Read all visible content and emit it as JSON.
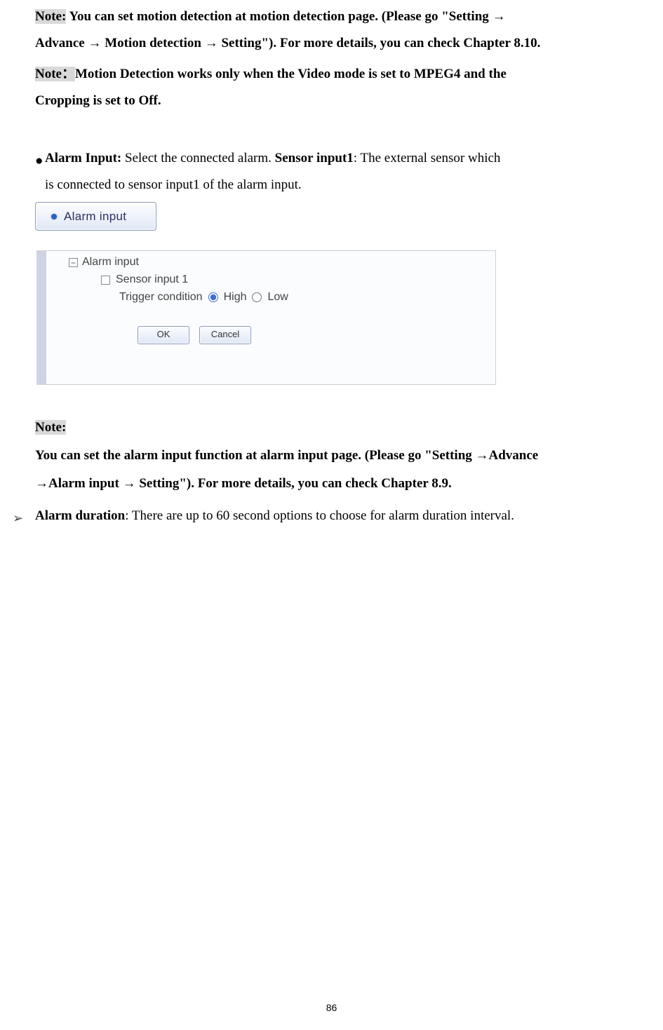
{
  "p1": {
    "note_label": "Note:",
    "rest1": " You can set motion detection at motion detection page. (Please go \"Setting →",
    "line2": "Advance → Motion detection → Setting\"). For more details, you can check Chapter 8.10."
  },
  "p2": {
    "note_label": "Note：",
    "rest1": "Motion Detection works only when the Video mode is set to MPEG4 and the",
    "line2": "Cropping is set to Off."
  },
  "alarm_input": {
    "label_bold": "Alarm Input: ",
    "mid": "Select the connected alarm. ",
    "sensor_bold": "Sensor input1",
    "after": ": The external sensor which",
    "line2": "is connected to sensor input1 of the alarm input."
  },
  "btn_alarm_input": "Alarm input",
  "panel": {
    "heading": "Alarm input",
    "sensor1": "Sensor input 1",
    "trigger": "Trigger condition",
    "high": "High",
    "low": "Low",
    "ok": "OK",
    "cancel": "Cancel"
  },
  "note3": {
    "label": "Note:  ",
    "l1": "You can set the alarm input function at alarm input page. (Please go \"Setting →Advance",
    "l2": "→Alarm input → Setting\"). For more details, you can check Chapter 8.9."
  },
  "alarm_duration": {
    "label": "Alarm duration",
    "rest": ": There are up to 60 second options to choose for alarm duration interval."
  },
  "page_number": "86"
}
